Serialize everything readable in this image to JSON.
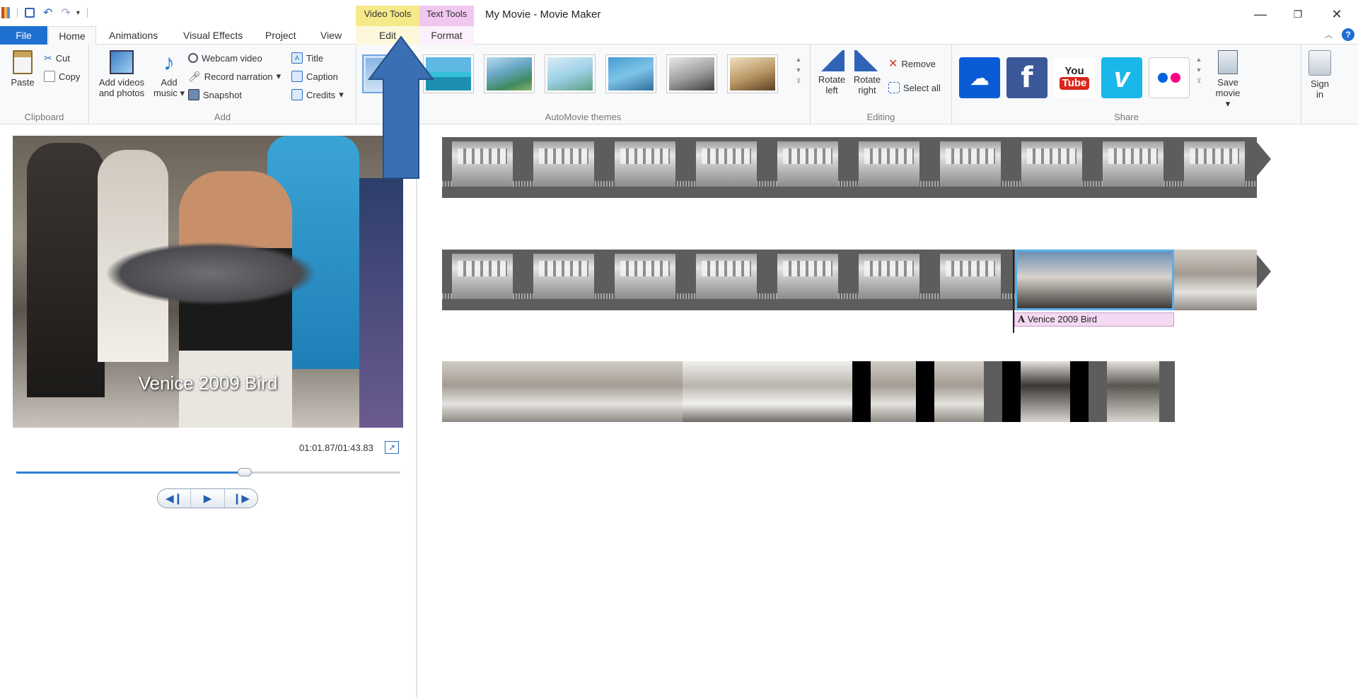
{
  "window": {
    "app_title": "My Movie - Movie Maker",
    "context_tabs": {
      "video_tools": "Video Tools",
      "text_tools": "Text Tools"
    }
  },
  "tabs": [
    "File",
    "Home",
    "Animations",
    "Visual Effects",
    "Project",
    "View",
    "Edit",
    "Format"
  ],
  "ribbon": {
    "clipboard": {
      "paste": "Paste",
      "cut": "Cut",
      "copy": "Copy",
      "label": "Clipboard"
    },
    "add": {
      "add_videos": "Add videos",
      "add_videos_2": "and photos",
      "add_music": "Add",
      "add_music_2": "music",
      "webcam": "Webcam video",
      "narration": "Record narration",
      "snapshot": "Snapshot",
      "title": "Title",
      "caption": "Caption",
      "credits": "Credits",
      "label": "Add"
    },
    "themes": {
      "label": "AutoMovie themes"
    },
    "editing": {
      "rotate_left": "Rotate",
      "rotate_left_2": "left",
      "rotate_right": "Rotate",
      "rotate_right_2": "right",
      "remove": "Remove",
      "select_all": "Select all",
      "label": "Editing"
    },
    "share": {
      "save_movie": "Save",
      "save_movie_2": "movie",
      "sign_in": "Sign",
      "sign_in_2": "in",
      "label": "Share",
      "youtube_1": "You",
      "youtube_2": "Tube"
    }
  },
  "preview": {
    "caption_text": "Venice 2009 Bird",
    "timecode": "01:01.87/01:43.83",
    "progress_fraction": 0.594
  },
  "storyboard": {
    "text_clip": "Venice 2009 Bird"
  },
  "colors": {
    "file_tab": "#1e6fd0",
    "video_tools": "#f6e98a",
    "text_tools": "#efc7ef",
    "onedrive": "#0a5bd5",
    "facebook": "#3b5998",
    "youtube": "#d9261c",
    "vimeo": "#1ab7ea",
    "flickr_blue": "#0063dc",
    "flickr_pink": "#ff0084",
    "annotation_arrow": "#3a6fb3"
  }
}
